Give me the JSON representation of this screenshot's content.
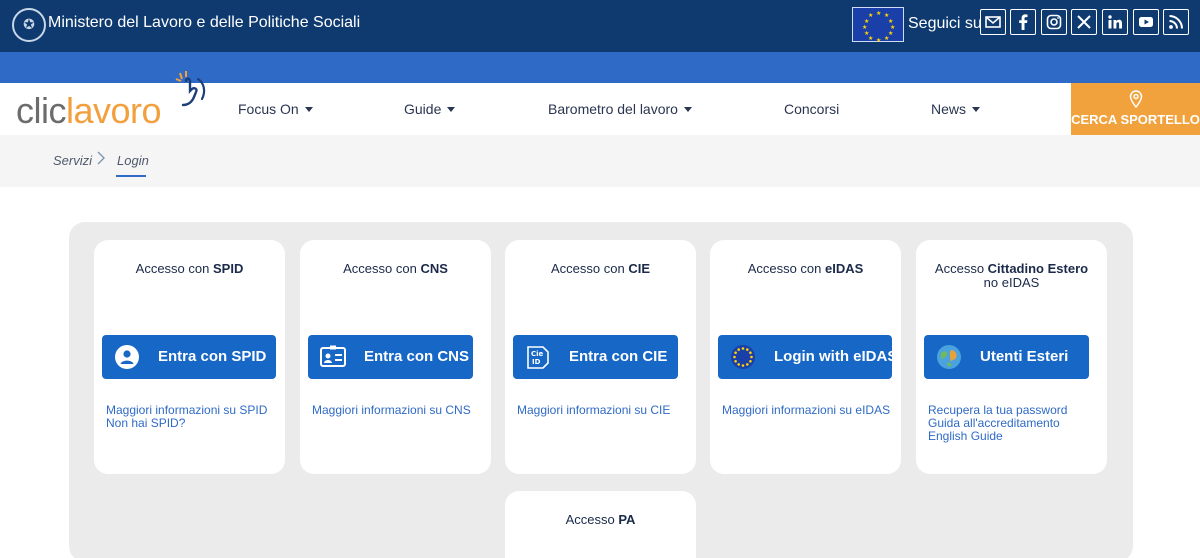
{
  "header": {
    "ministry_name": "Ministero del Lavoro e delle Politiche Sociali",
    "follow_label": "Seguici su:",
    "social": [
      "mail-icon",
      "facebook-icon",
      "instagram-icon",
      "x-icon",
      "linkedin-icon",
      "youtube-icon",
      "rss-icon"
    ]
  },
  "brand": {
    "part1": "clic",
    "part2": "lavoro"
  },
  "nav": {
    "items": [
      "Focus On",
      "Guide",
      "Barometro del lavoro",
      "Concorsi",
      "News"
    ],
    "cta": "CERCA SPORTELLO"
  },
  "breadcrumb": {
    "items": [
      "Servizi",
      "Login"
    ]
  },
  "access_cards": [
    {
      "title_prefix": "Accesso con ",
      "title_strong": "SPID",
      "title_suffix": "",
      "button": "Entra con SPID",
      "links": [
        "Maggiori informazioni su SPID",
        "Non hai SPID?"
      ],
      "icon": "user-icon"
    },
    {
      "title_prefix": "Accesso con ",
      "title_strong": "CNS",
      "title_suffix": "",
      "button": "Entra con CNS",
      "links": [
        "Maggiori informazioni su CNS"
      ],
      "icon": "id-card-icon"
    },
    {
      "title_prefix": "Accesso con ",
      "title_strong": "CIE",
      "title_suffix": "",
      "button": "Entra con CIE",
      "links": [
        "Maggiori informazioni su CIE"
      ],
      "icon": "cie-icon"
    },
    {
      "title_prefix": "Accesso con ",
      "title_strong": "eIDAS",
      "title_suffix": "",
      "button": "Login with eIDAS",
      "links": [
        "Maggiori informazioni su eIDAS"
      ],
      "icon": "eu-stars-icon"
    },
    {
      "title_prefix": "Accesso ",
      "title_strong": "Cittadino Estero",
      "title_suffix": "no eIDAS",
      "button": "Utenti Esteri",
      "links": [
        "Recupera la tua password",
        "Guida all'accreditamento",
        "English Guide"
      ],
      "icon": "globe-icon"
    },
    {
      "title_prefix": "Accesso ",
      "title_strong": "PA",
      "title_suffix": "",
      "button": "",
      "links": [],
      "icon": ""
    }
  ],
  "colors": {
    "ministry_bar": "#0e3a70",
    "accent_blue": "#1767c6",
    "brand_orange": "#f2a03d",
    "panel_bg": "#ebebeb"
  }
}
